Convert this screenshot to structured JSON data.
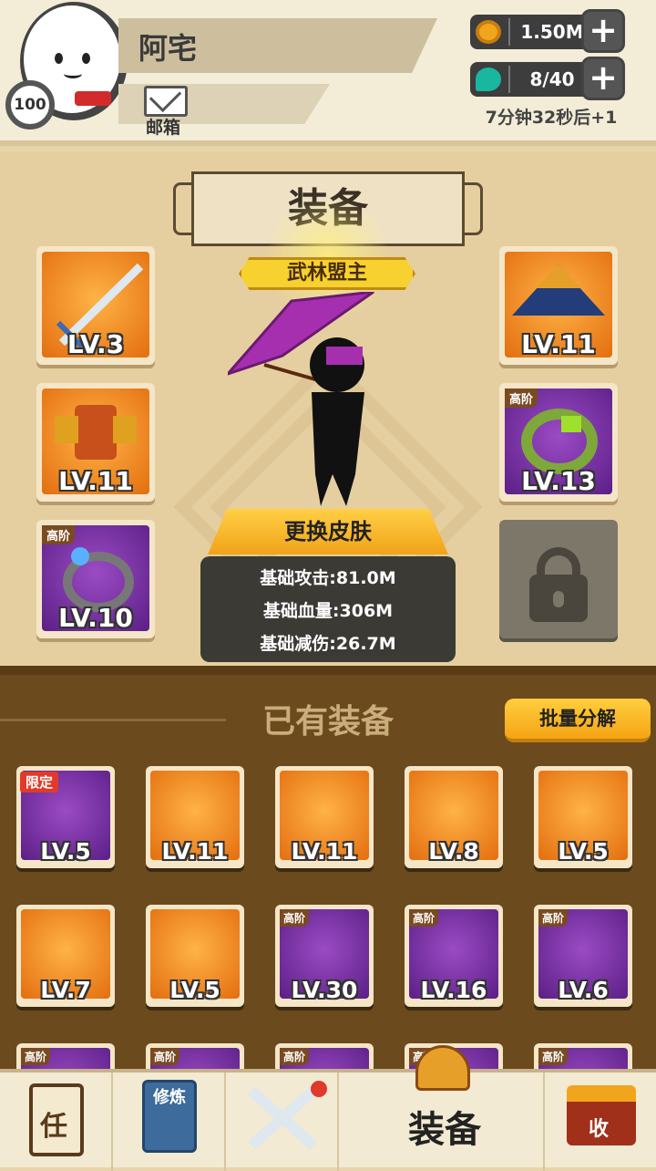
{
  "player": {
    "name": "阿宅",
    "level": "100"
  },
  "header": {
    "mail_label": "邮箱"
  },
  "resources": {
    "gold": {
      "value": "1.50M",
      "icon": "coin-icon"
    },
    "stamina": {
      "value": "8/40",
      "icon": "gem-icon"
    },
    "timer": "7分钟32秒后+1",
    "plus_label": "+"
  },
  "equip": {
    "title": "装备",
    "title_badge": "武林盟主",
    "skin_button": "更换皮肤",
    "stats": [
      "基础攻击:81.0M",
      "基础血量:306M",
      "基础减伤:26.7M"
    ],
    "slots": [
      {
        "name": "weapon-slot",
        "lv": "LV.3",
        "color": "orange",
        "tier": ""
      },
      {
        "name": "armor-slot",
        "lv": "LV.11",
        "color": "orange",
        "tier": ""
      },
      {
        "name": "ring-slot",
        "lv": "LV.10",
        "color": "purple",
        "tier": "高阶"
      },
      {
        "name": "hat-slot",
        "lv": "LV.11",
        "color": "orange",
        "tier": ""
      },
      {
        "name": "bracelet-slot",
        "lv": "LV.13",
        "color": "purple",
        "tier": "高阶"
      }
    ]
  },
  "inventory": {
    "title": "已有装备",
    "bulk_button": "批量分解",
    "items": [
      {
        "lv": "LV.5",
        "color": "purple",
        "tag": "限定"
      },
      {
        "lv": "LV.11",
        "color": "orange",
        "tag": ""
      },
      {
        "lv": "LV.11",
        "color": "orange",
        "tag": ""
      },
      {
        "lv": "LV.8",
        "color": "orange",
        "tag": ""
      },
      {
        "lv": "LV.5",
        "color": "orange",
        "tag": ""
      },
      {
        "lv": "LV.7",
        "color": "orange",
        "tag": ""
      },
      {
        "lv": "LV.5",
        "color": "orange",
        "tag": ""
      },
      {
        "lv": "LV.30",
        "color": "purple",
        "tag": "高阶"
      },
      {
        "lv": "LV.16",
        "color": "purple",
        "tag": "高阶"
      },
      {
        "lv": "LV.6",
        "color": "purple",
        "tag": "高阶"
      },
      {
        "lv": "",
        "color": "purple",
        "tag": "高阶"
      },
      {
        "lv": "",
        "color": "purple",
        "tag": "高阶"
      },
      {
        "lv": "",
        "color": "purple",
        "tag": "高阶"
      },
      {
        "lv": "",
        "color": "purple",
        "tag": "高阶"
      },
      {
        "lv": "",
        "color": "purple",
        "tag": "高阶"
      }
    ]
  },
  "nav": {
    "task_icon_text": "任",
    "cultivate_icon_text": "修炼",
    "equip_label": "装备",
    "collect_icon_text": "收"
  },
  "colors": {
    "accent": "#f4a414",
    "bg": "#e5cfa0",
    "inventory_bg": "#6b4a1e"
  }
}
